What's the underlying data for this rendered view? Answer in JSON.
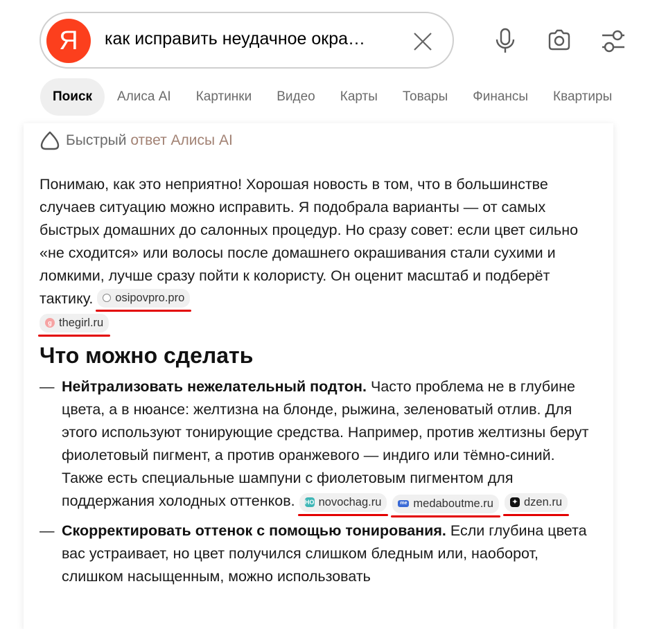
{
  "search": {
    "logo_letter": "Я",
    "query": "как исправить неудачное окра…"
  },
  "tabs": [
    {
      "label": "Поиск",
      "active": true
    },
    {
      "label": "Алиса AI"
    },
    {
      "label": "Картинки"
    },
    {
      "label": "Видео"
    },
    {
      "label": "Карты"
    },
    {
      "label": "Товары"
    },
    {
      "label": "Финансы"
    },
    {
      "label": "Квартиры"
    }
  ],
  "answer": {
    "header_prefix": "Быстрый ",
    "header_accent": "ответ Алисы AI",
    "intro": "Понимаю, как это неприятно! Хорошая новость в том, что в большинстве случаев ситуацию можно исправить. Я подобрала варианты — от самых быстрых домашних до салонных процедур. Но сразу совет: если цвет сильно «не сходится» или волосы после домашнего окрашивания стали сухими и ломкими, лучше сразу пойти к колористу. Он оценит масштаб и подберёт тактику.",
    "intro_sources": [
      "osipovpro.pro",
      "thegirl.ru"
    ],
    "section_title": "Что можно сделать",
    "items": [
      {
        "bold": "Нейтрализовать нежелательный подтон.",
        "text": " Часто проблема не в глубине цвета, а в нюансе: желтизна на блонде, рыжина, зеленоватый отлив. Для этого используют тонирующие средства. Например, против желтизны берут фиолетовый пигмент, а против оранжевого — индиго или тёмно-синий. Также есть специальные шампуни с фиолетовым пигментом для поддержания холодных оттенков.",
        "sources": [
          "novochag.ru",
          "medaboutme.ru",
          "dzen.ru"
        ]
      },
      {
        "bold": "Скорректировать оттенок с помощью тонирования.",
        "text": " Если глубина цвета вас устраивает, но цвет получился слишком бледным или, наоборот, слишком насыщенным, можно использовать"
      }
    ]
  },
  "icons": {
    "clear": "close-icon",
    "voice": "microphone-icon",
    "camera": "camera-search-icon",
    "filters": "settings-sliders-icon",
    "alice": "alice-icon"
  },
  "colors": {
    "brand": "#fc3f1d",
    "accent_text": "#a28274",
    "underline": "#e30000"
  }
}
